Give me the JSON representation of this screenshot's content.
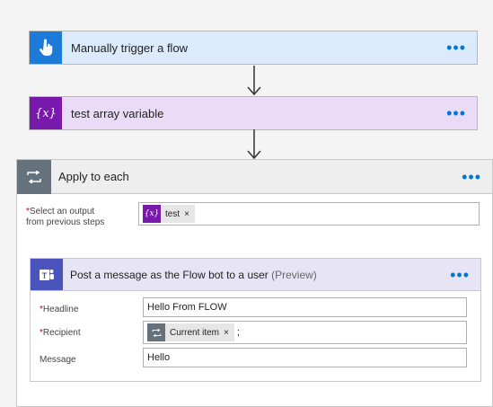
{
  "trigger": {
    "title": "Manually trigger a flow",
    "menu": "•••"
  },
  "variable": {
    "title": "test array variable",
    "menu": "•••"
  },
  "apply_each": {
    "title": "Apply to each",
    "menu": "•••",
    "select_output": {
      "required_mark": "*",
      "label_line1": "Select an output",
      "label_line2": "from previous steps",
      "token": {
        "icon": "variable-icon",
        "label": "test",
        "close": "×"
      }
    },
    "post": {
      "title": "Post a message as the Flow bot to a user",
      "preview_tag": "(Preview)",
      "menu": "•••",
      "headline": {
        "required_mark": "*",
        "label": "Headline",
        "value": "Hello From FLOW"
      },
      "recipient": {
        "required_mark": "*",
        "label": "Recipient",
        "token": {
          "icon": "loop-icon",
          "label": "Current item",
          "close": "×"
        },
        "suffix": ";"
      },
      "message": {
        "label": "Message",
        "value": "Hello"
      }
    }
  },
  "colors": {
    "trigger_icon": "#1e7ad8",
    "variable_icon": "#7719aa",
    "loop_icon": "#65727c",
    "teams_icon": "#4b53bc",
    "accent": "#0078d4"
  }
}
